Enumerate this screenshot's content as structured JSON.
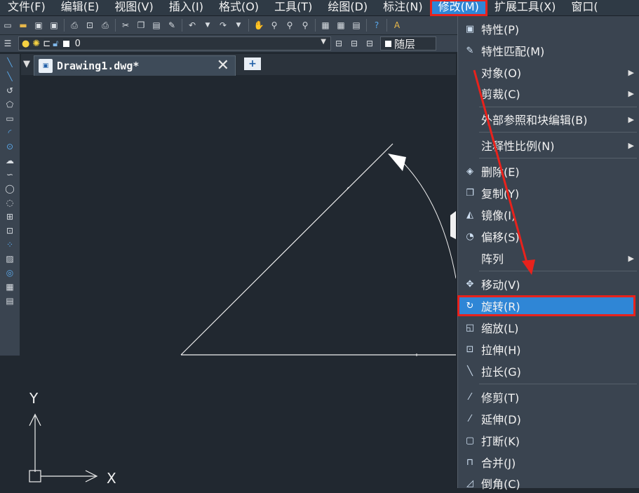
{
  "menubar": {
    "items": [
      "文件(F)",
      "编辑(E)",
      "视图(V)",
      "插入(I)",
      "格式(O)",
      "工具(T)",
      "绘图(D)",
      "标注(N)",
      "修改(M)",
      "扩展工具(X)",
      "窗口("
    ],
    "active_index": 8
  },
  "toolbar": {
    "layer_value": "0",
    "linetype_value": "随层"
  },
  "tabs": {
    "document_title": "Drawing1.dwg*",
    "close_glyph": "✕",
    "new_tab_glyph": "+"
  },
  "canvas": {
    "axis_y": "Y",
    "axis_x": "X"
  },
  "modify_menu": {
    "items": [
      {
        "label": "特性(P)",
        "icon": "properties-icon"
      },
      {
        "label": "特性匹配(M)",
        "icon": "match-properties-icon"
      },
      {
        "label": "对象(O)",
        "submenu": true
      },
      {
        "label": "剪裁(C)",
        "submenu": true
      },
      {
        "label": "外部参照和块编辑(B)",
        "submenu": true
      },
      {
        "label": "注释性比例(N)",
        "submenu": true
      },
      {
        "label": "删除(E)",
        "icon": "eraser-icon"
      },
      {
        "label": "复制(Y)",
        "icon": "copy-icon"
      },
      {
        "label": "镜像(I)",
        "icon": "mirror-icon"
      },
      {
        "label": "偏移(S)",
        "icon": "offset-icon"
      },
      {
        "label": "阵列",
        "submenu": true
      },
      {
        "label": "移动(V)",
        "icon": "move-icon"
      },
      {
        "label": "旋转(R)",
        "icon": "rotate-icon",
        "highlighted": true
      },
      {
        "label": "缩放(L)",
        "icon": "scale-icon"
      },
      {
        "label": "拉伸(H)",
        "icon": "stretch-icon"
      },
      {
        "label": "拉长(G)",
        "icon": "lengthen-icon"
      },
      {
        "label": "修剪(T)",
        "icon": "trim-icon"
      },
      {
        "label": "延伸(D)",
        "icon": "extend-icon"
      },
      {
        "label": "打断(K)",
        "icon": "break-icon"
      },
      {
        "label": "合并(J)",
        "icon": "join-icon"
      },
      {
        "label": "倒角(C)",
        "icon": "chamfer-icon"
      }
    ]
  },
  "colors": {
    "highlight": "#2f86d6",
    "annotation_red": "#e8221c",
    "canvas_bg": "#212830"
  }
}
